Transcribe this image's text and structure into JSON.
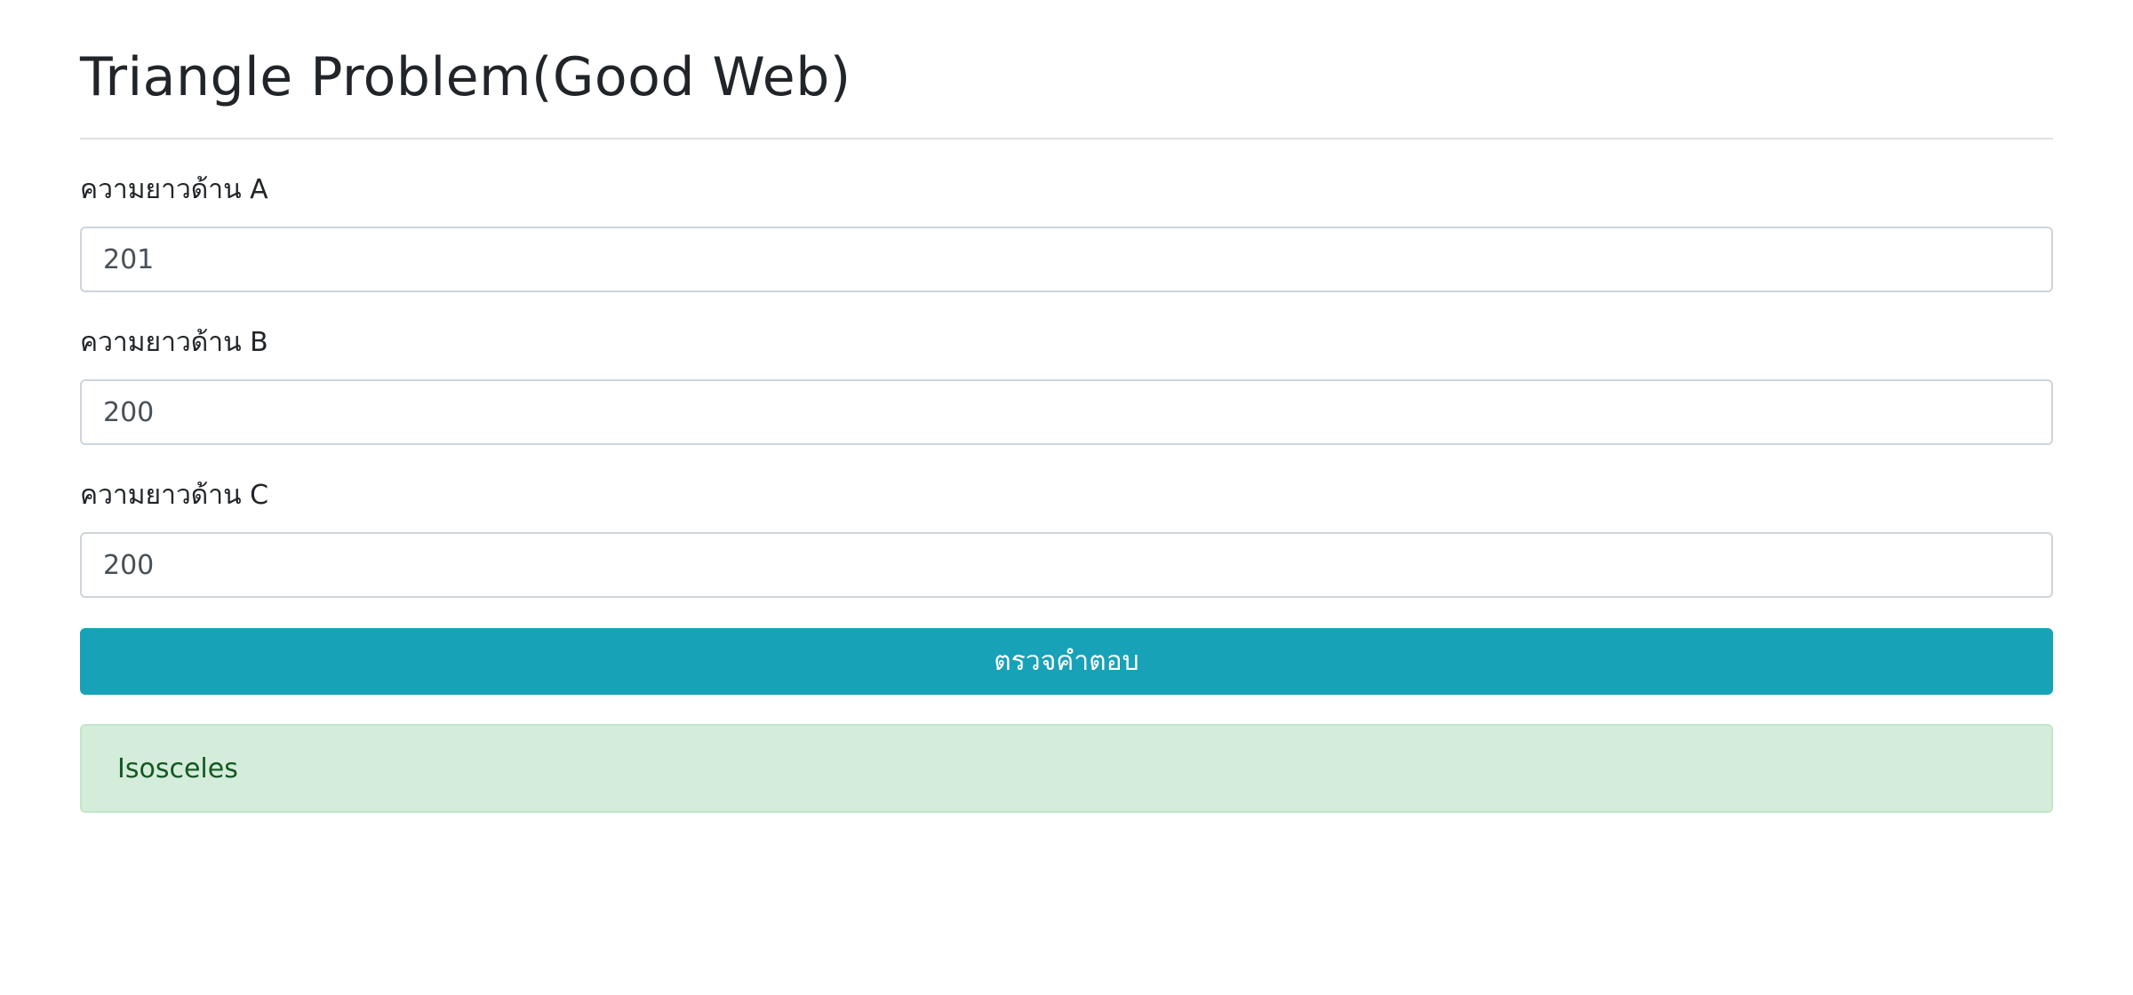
{
  "page": {
    "title": "Triangle Problem(Good Web)"
  },
  "form": {
    "side_a": {
      "label": "ความยาวด้าน A",
      "value": "201"
    },
    "side_b": {
      "label": "ความยาวด้าน B",
      "value": "200"
    },
    "side_c": {
      "label": "ความยาวด้าน C",
      "value": "200"
    },
    "submit_label": "ตรวจคำตอบ"
  },
  "result": {
    "text": "Isosceles"
  },
  "colors": {
    "button": "#17a2b8",
    "alert_background": "#d4edda",
    "alert_text": "#155724"
  }
}
